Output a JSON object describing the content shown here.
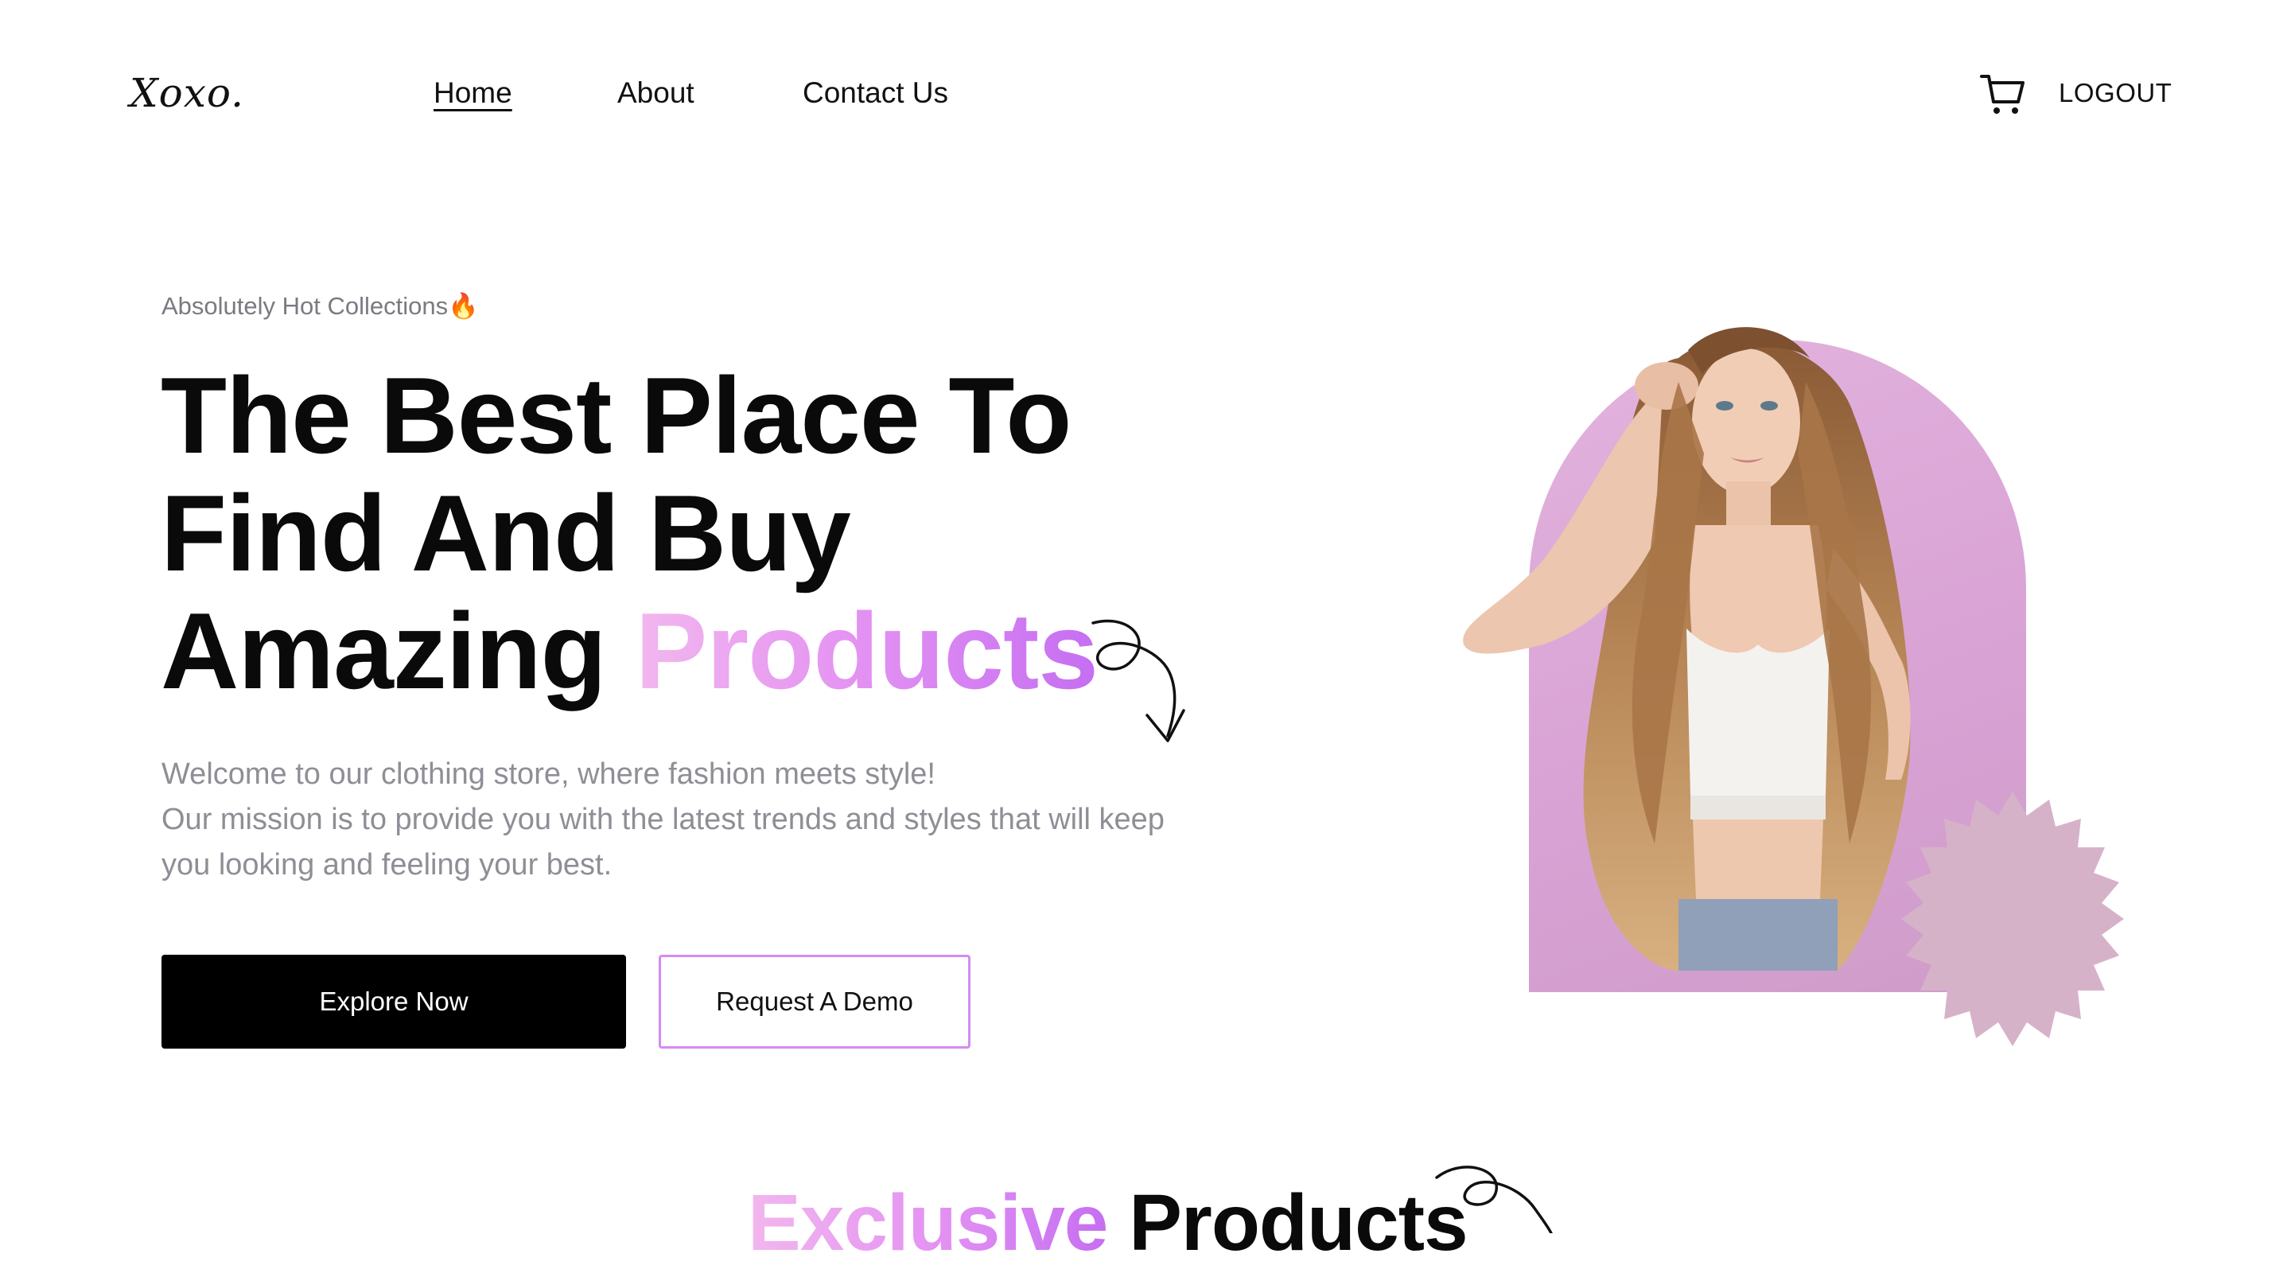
{
  "header": {
    "logo": "Xoxo.",
    "nav": [
      {
        "label": "Home",
        "active": true
      },
      {
        "label": "About",
        "active": false
      },
      {
        "label": "Contact Us",
        "active": false
      }
    ],
    "cart_icon": "cart-icon",
    "logout_label": "LOGOUT"
  },
  "hero": {
    "tagline": "Absolutely Hot Collections🔥",
    "headline_line1": "The Best Place To",
    "headline_line2": "Find And Buy",
    "headline_line3_plain": "Amazing ",
    "headline_line3_accent": "Products",
    "paragraph_line1": "Welcome to our clothing store, where fashion meets style!",
    "paragraph_line2": "Our mission is to provide you with the latest trends and styles that will keep",
    "paragraph_line3": "you looking and feeling your best.",
    "primary_button": "Explore Now",
    "secondary_button": "Request A Demo",
    "decor_icon": "curly-arrow-icon"
  },
  "section": {
    "title_accent": "Exclusive",
    "title_plain": " Products",
    "decor_icon": "curly-arrow-icon"
  },
  "colors": {
    "accent_gradient_start": "#f2b7ee",
    "accent_gradient_end": "#c56ef2",
    "arch_pink": "#dba8d6",
    "badge_mauve": "#d6b2c8",
    "button_black": "#000000",
    "muted_text": "#8e8e96"
  }
}
